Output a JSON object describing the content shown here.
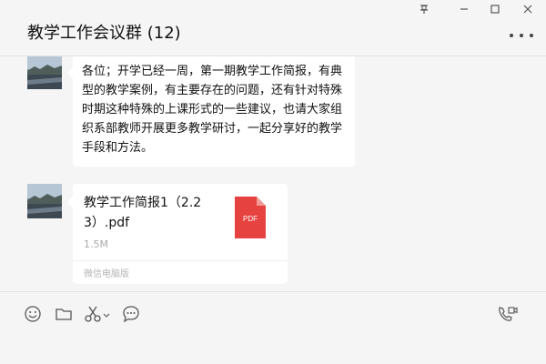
{
  "window": {
    "title": "教学工作会议群 (12)",
    "controls": {
      "pin": "pin-icon",
      "minimize": "minimize-icon",
      "maximize": "maximize-icon",
      "close": "close-icon"
    },
    "more_icon": "more-icon"
  },
  "messages": [
    {
      "type": "text",
      "avatar_icon": "landscape-avatar",
      "text": "各位；开学已经一周，第一期教学工作简报，有典型的教学案例，有主要存在的问题，还有针对特殊时期这种特殊的上课形式的一些建议，也请大家组织系部教师开展更多教学研讨，一起分享好的教学手段和方法。"
    },
    {
      "type": "file",
      "avatar_icon": "landscape-avatar",
      "file": {
        "name": "教学工作简报1（2.23）.pdf",
        "size": "1.5M",
        "badge": "PDF",
        "source": "微信电脑版",
        "icon": "pdf-icon",
        "icon_color": "#e64340"
      }
    }
  ],
  "toolbar": {
    "icons": [
      "emoji-icon",
      "folder-icon",
      "scissors-icon",
      "chat-history-icon",
      "video-call-icon"
    ]
  },
  "colors": {
    "background": "#f5f5f5",
    "bubble": "#ffffff",
    "pdf": "#e64340"
  }
}
